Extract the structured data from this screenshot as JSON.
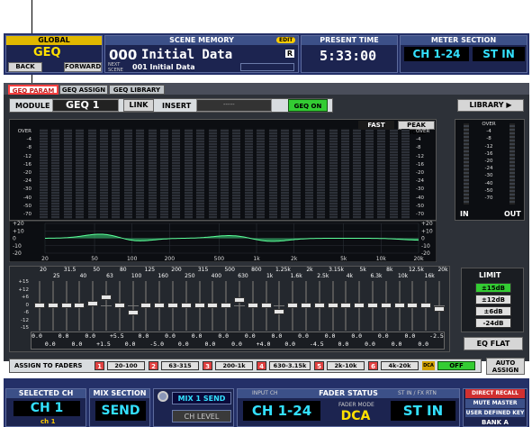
{
  "global": {
    "label": "GLOBAL",
    "value": "GEQ",
    "back": "BACK",
    "forward": "FORWARD"
  },
  "scene": {
    "label": "SCENE MEMORY",
    "edit": "EDIT",
    "number": "000",
    "title": "Initial Data",
    "r": "R",
    "next_label_1": "NEXT",
    "next_label_2": "SCENE",
    "next_title": "001 Initial Data"
  },
  "time": {
    "label": "PRESENT TIME",
    "value": "5:33:00"
  },
  "meter_section": {
    "label": "METER SECTION",
    "left": "CH 1-24",
    "right": "ST IN"
  },
  "tabs": [
    "GEQ PARAM",
    "GEQ ASSIGN",
    "GEQ LIBRARY"
  ],
  "module": {
    "label": "MODULE",
    "value": "GEQ 1",
    "link": "LINK",
    "insert": "INSERT",
    "insert_value": "-----",
    "geq_on": "GEQ ON",
    "library": "LIBRARY"
  },
  "meter": {
    "fast": "FAST",
    "peak_hold": "PEAK HOLD",
    "scale": [
      "OVER",
      "-4",
      "-8",
      "-12",
      "-16",
      "-20",
      "-24",
      "-30",
      "-40",
      "-50",
      "-70"
    ],
    "in": "IN",
    "out": "OUT"
  },
  "graph": {
    "y_labels": [
      "+20",
      "+10",
      "0",
      "-10",
      "-20"
    ],
    "x_labels": [
      "20",
      "50",
      "100",
      "200",
      "500",
      "1k",
      "2k",
      "5k",
      "10k",
      "20k"
    ]
  },
  "faders": {
    "freq_top": [
      "20",
      "31.5",
      "50",
      "80",
      "125",
      "200",
      "315",
      "500",
      "800",
      "1.25k",
      "2k",
      "3.15k",
      "5k",
      "8k",
      "12.5k",
      "20k"
    ],
    "freq_bottom": [
      "25",
      "40",
      "63",
      "100",
      "160",
      "250",
      "400",
      "630",
      "1k",
      "1.6k",
      "2.5k",
      "4k",
      "6.3k",
      "10k",
      "16k"
    ],
    "scale": [
      "+15",
      "+12",
      "+6",
      "0",
      "-6",
      "-12",
      "-15"
    ],
    "values_top": [
      "0.0",
      "0.0",
      "0.0",
      "+5.5",
      "0.0",
      "0.0",
      "0.0",
      "0.0",
      "0.0",
      "0.0",
      "0.0",
      "0.0",
      "0.0",
      "0.0",
      "0.0",
      "-2.5"
    ],
    "values_bottom": [
      "0.0",
      "0.0",
      "+1.5",
      "0.0",
      "-5.0",
      "0.0",
      "0.0",
      "0.0",
      "+4.0",
      "0.0",
      "-4.5",
      "0.0",
      "0.0",
      "0.0",
      "0.0"
    ],
    "gains": [
      0,
      0,
      0,
      0,
      1.5,
      5.5,
      0,
      -5.0,
      0,
      0,
      0,
      0,
      0,
      0,
      0,
      4.0,
      0,
      0,
      -4.5,
      0,
      0,
      0,
      0,
      0,
      0,
      0,
      0,
      0,
      0,
      0,
      -2.5
    ]
  },
  "limit": {
    "label": "LIMIT",
    "options": [
      "±15dB",
      "±12dB",
      "±6dB",
      "-24dB"
    ],
    "eq_flat": "EQ FLAT"
  },
  "assign": {
    "label": "ASSIGN TO FADERS",
    "groups": [
      {
        "n": "1",
        "range": "20-100",
        "color": "#e04040"
      },
      {
        "n": "2",
        "range": "63-315",
        "color": "#e04040"
      },
      {
        "n": "3",
        "range": "200-1k",
        "color": "#e04040"
      },
      {
        "n": "4",
        "range": "630-3.15k",
        "color": "#e04040"
      },
      {
        "n": "5",
        "range": "2k-10k",
        "color": "#e04040"
      },
      {
        "n": "6",
        "range": "4k-20k",
        "color": "#e04040"
      }
    ],
    "dca": "DCA",
    "off": "OFF",
    "auto_1": "AUTO",
    "auto_2": "ASSIGN"
  },
  "footer": {
    "selected_ch": "SELECTED CH",
    "ch": "CH 1",
    "ch_sub": "ch 1",
    "mix_section": "MIX SECTION",
    "send": "SEND",
    "mix1_send": "MIX 1 SEND",
    "ch_level": "CH LEVEL",
    "input_ch": "INPUT CH",
    "fader_status": "FADER STATUS",
    "st_in_fx": "ST IN / FX RTN",
    "ch_range": "CH 1-24",
    "fader_mode": "FADER MODE",
    "dca": "DCA",
    "st_in": "ST IN",
    "direct_recall": "DIRECT RECALL",
    "mute_master": "MUTE MASTER",
    "user_defined": "USER DEFINED KEY",
    "bank": "BANK A"
  }
}
